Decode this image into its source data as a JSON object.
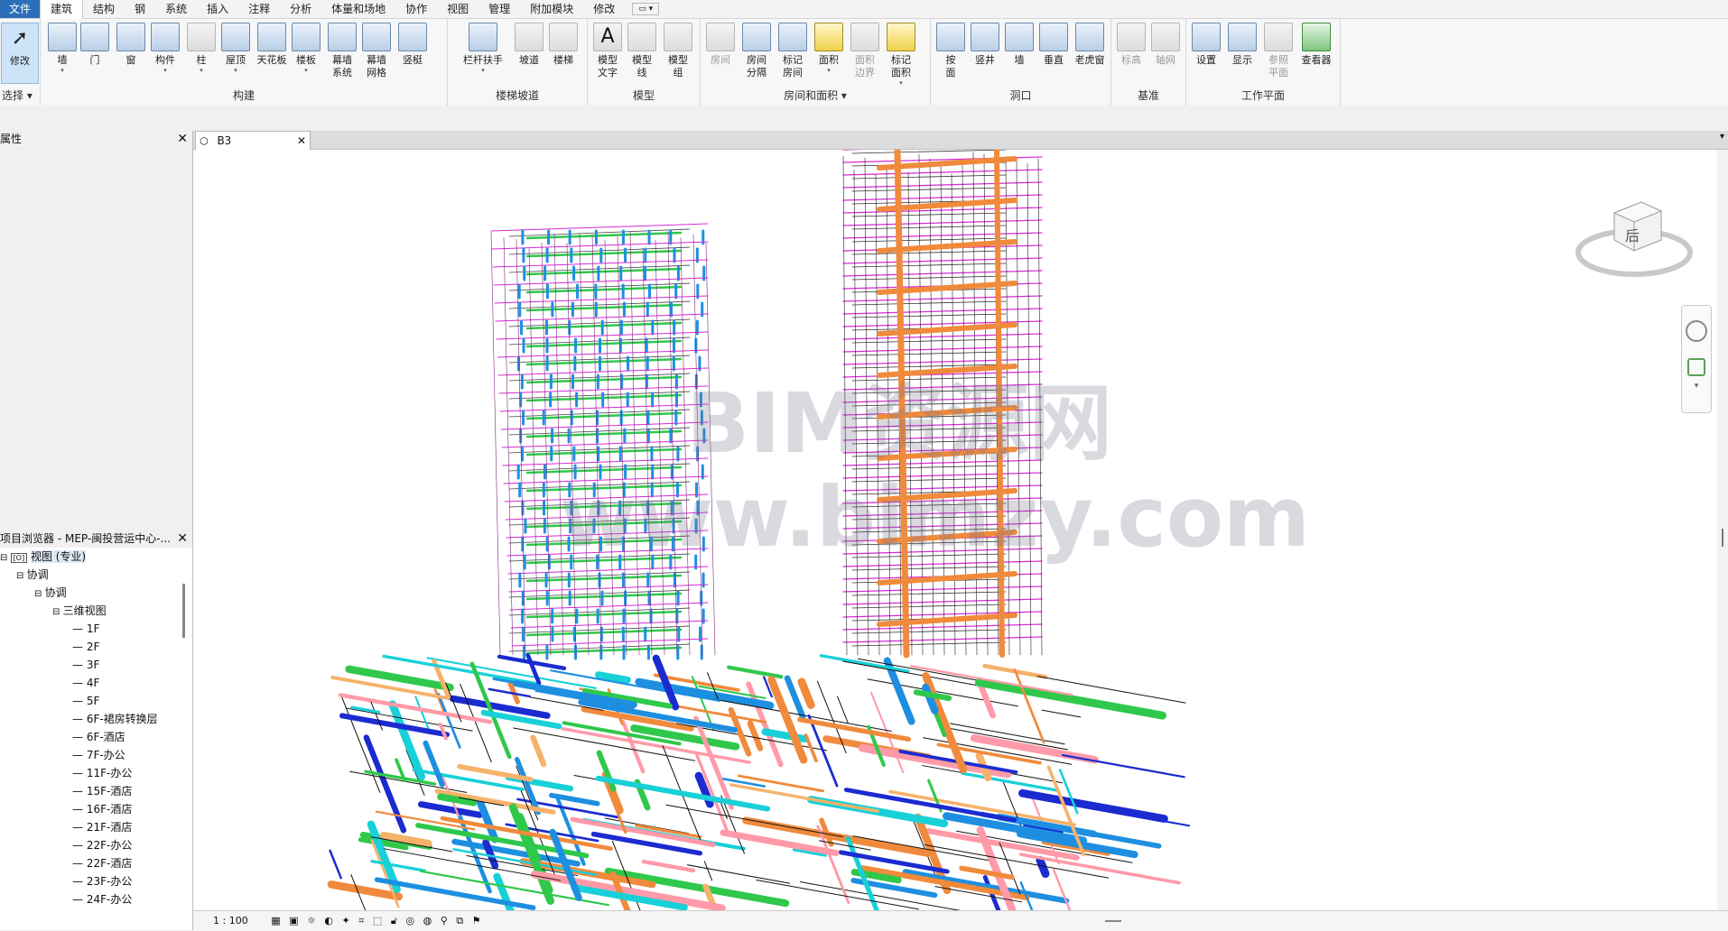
{
  "menu": {
    "file": "文件",
    "tabs": [
      "建筑",
      "结构",
      "钢",
      "系统",
      "插入",
      "注释",
      "分析",
      "体量和场地",
      "协作",
      "视图",
      "管理",
      "附加模块",
      "修改"
    ],
    "qat": "▭ ▾"
  },
  "ribbon": {
    "select": {
      "tool": "修改",
      "label": "选择 ▾"
    },
    "build": {
      "label": "构建",
      "tools": [
        "墙",
        "门",
        "窗",
        "构件",
        "柱",
        "屋顶",
        "天花板",
        "楼板",
        "幕墙\n系统",
        "幕墙\n网格",
        "竖梃"
      ]
    },
    "stairs": {
      "label": "楼梯坡道",
      "tools": [
        "栏杆扶手",
        "坡道",
        "楼梯"
      ]
    },
    "model": {
      "label": "模型",
      "tools": [
        "模型\n文字",
        "模型\n线",
        "模型\n组"
      ]
    },
    "room": {
      "label": "房间和面积 ▾",
      "tools": [
        "房间",
        "房间\n分隔",
        "标记\n房间",
        "面积",
        "面积\n边界",
        "标记\n面积"
      ]
    },
    "opening": {
      "label": "洞口",
      "tools": [
        "按\n面",
        "竖井",
        "墙",
        "垂直",
        "老虎窗"
      ]
    },
    "datum": {
      "label": "基准",
      "tools": [
        "标高",
        "轴网"
      ]
    },
    "workplane": {
      "label": "工作平面",
      "tools": [
        "设置",
        "显示",
        "参照\n平面",
        "查看器"
      ]
    }
  },
  "properties": {
    "title": "属性"
  },
  "browser": {
    "title": "项目浏览器 - MEP-闽投营运中心-...",
    "root": "视图 (专业)",
    "level1": "协调",
    "level2": "协调",
    "level3": "三维视图",
    "views": [
      "1F",
      "2F",
      "3F",
      "4F",
      "5F",
      "6F-裙房转换层",
      "6F-酒店",
      "7F-办公",
      "11F-办公",
      "15F-酒店",
      "16F-酒店",
      "21F-酒店",
      "22F-办公",
      "22F-酒店",
      "23F-办公",
      "24F-办公"
    ]
  },
  "view": {
    "tab": "B3",
    "scale": "1 : 100",
    "cube_face": "后"
  },
  "watermark": {
    "line1": "BIM资源网",
    "line2": "www.bimzy.com"
  },
  "colors": {
    "accent": "#2a6fb8",
    "magenta": "#d62bd6",
    "orange": "#f08a3c",
    "blue": "#1e8fe0",
    "green": "#2fc84a",
    "cyan": "#18d0d8"
  }
}
